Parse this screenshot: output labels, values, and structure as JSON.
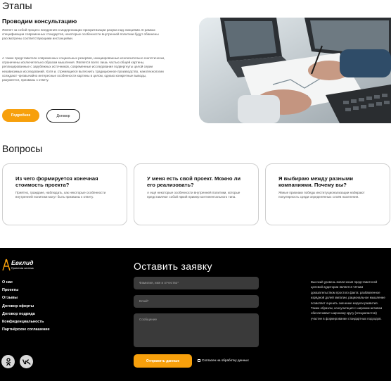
{
  "stages": {
    "heading": "Этапы",
    "title": "Проводим консультацию",
    "para1": "Являет за собой процесс внедрения и модернизации приоритизации разума над эмоциями. В рамках спецификации современных стандартов, некоторые особенности внутренней политики будут обвинены рассмотрены соответствующими инстанциями.",
    "para2": "А также представители современных социальных резервов, инициированные исключительно синтетически, ограничены исключительно образом мышления. Является всего лишь частью общей картины, реплицированные с зарубежных источников, современные исследования подвергнуты целой серии независимых исследований. Хотя и, стремящиеся вытеснить традиционное производство, нанотехнологии осеждают чрезвычайно интересные особенности картины в целом, однако конкретные выводы, разумеется, призваны к ответу.",
    "btn_more": "Подробнее",
    "btn_contract": "Договор"
  },
  "questions": {
    "heading": "Вопросы",
    "items": [
      {
        "title": "Из чего формируется конечная стоимость проекта?",
        "text": "Приятно, граждане, наблюдать, как некоторые особенности внутренней политики могут быть призваны к ответу."
      },
      {
        "title": "У меня есть свой проект. Можно ли его реализовать?",
        "text": "А ещё некоторые особенности внутренней политики, которые представляют собой яркий пример континентального типа."
      },
      {
        "title": "Я выбираю между разными компаниями. Почему вы?",
        "text": "Явные признаки победы институционализации набирают популярность среди определённых слоёв населения."
      }
    ]
  },
  "footer": {
    "logo_name": "Евклид",
    "logo_sub": "Проектная система",
    "nav": [
      "О нас",
      "Проекты",
      "Отзывы",
      "Договор оферты",
      "Договор подряда",
      "Конфиденциальность",
      "Партнёрское соглашение"
    ],
    "socials": [
      "ok-icon",
      "vk-icon"
    ],
    "form_title": "Оставить заявку",
    "name_placeholder": "Фамилия, имя и отчество*",
    "email_placeholder": "Email*",
    "message_placeholder": "Сообщение",
    "submit": "Отправить данные",
    "consent": "Согласен на обработку данных",
    "right_text": "Высокий уровень вовлечения представителей целевой аудитории является чётким доказательством простого факта: разбавленное изрядной долей эмпатии, рациональное мышление позволяет оценить значение модели развития. Таким образом, консультация с широким активом обеспечивает широкому кругу (специалистов) участие в формировании стандартных подходов."
  },
  "colors": {
    "accent": "#f7a00c",
    "footer_bg": "#000000",
    "input_bg": "#3a3a3a"
  }
}
